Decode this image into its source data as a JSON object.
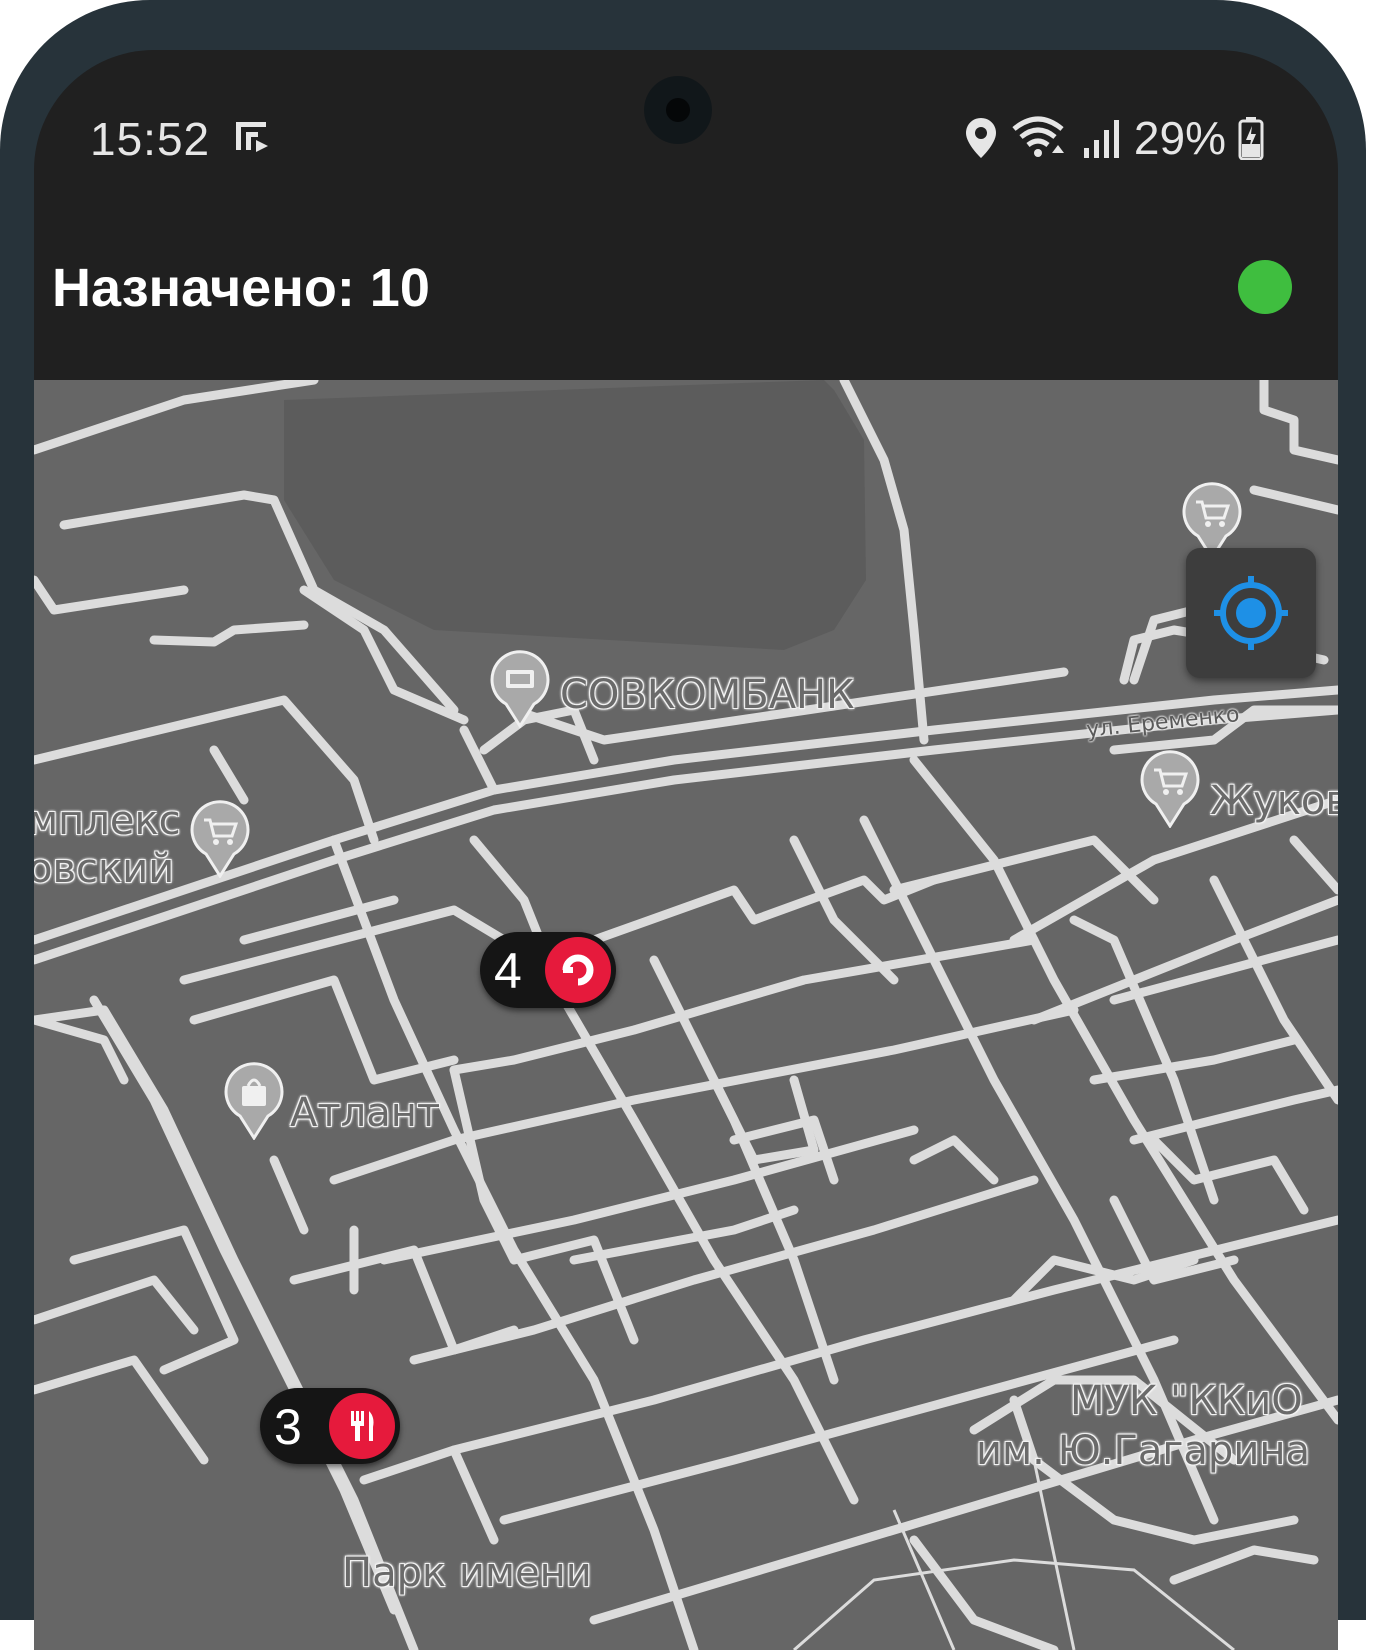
{
  "status_bar": {
    "time": "15:52",
    "battery": "29%",
    "icons": [
      "notification-icon",
      "location-icon",
      "wifi-icon",
      "signal-icon",
      "battery-icon"
    ]
  },
  "header": {
    "title": "Назначено: 10",
    "status_color": "#3fbe3f"
  },
  "map": {
    "labels": {
      "sovcombank": "СОВКОМБАНК",
      "street_eremenko": "ул. Еременко",
      "zhukov": "Жуков",
      "complex_line1": "мплекс",
      "complex_line2": "овский",
      "atlant": "Атлант",
      "muk_line1": "МУК \"ККиО",
      "muk_line2": "им. Ю.Гагарина",
      "park": "Парк имени"
    },
    "markers": [
      {
        "number": "4",
        "icon": "restart-icon"
      },
      {
        "number": "3",
        "icon": "restaurant-icon"
      }
    ]
  },
  "colors": {
    "map_bg": "#666666",
    "road": "#dcdcdc",
    "marker_badge": "#e61a3c",
    "locate_accent": "#1e90e6"
  }
}
